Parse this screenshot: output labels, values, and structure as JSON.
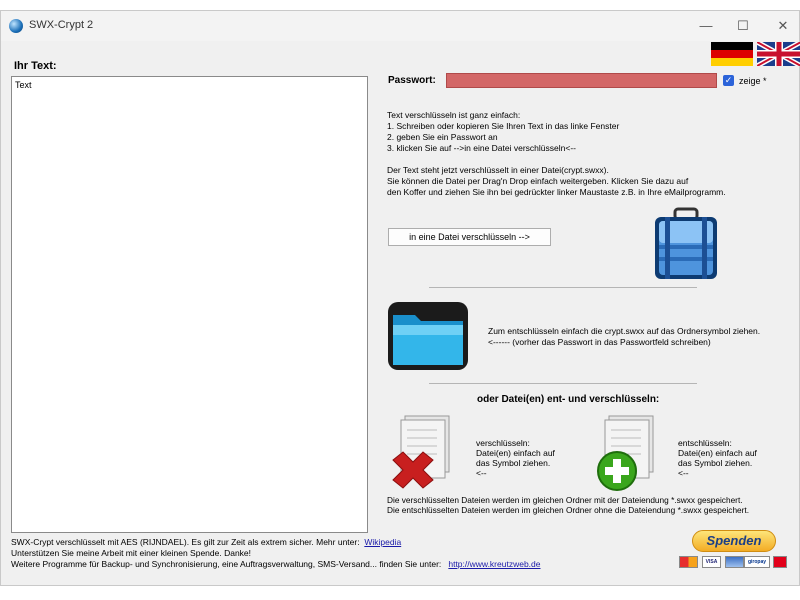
{
  "window": {
    "title": "SWX-Crypt 2",
    "controls": {
      "minimize": "—",
      "maximize": "☐",
      "close": "✕"
    }
  },
  "left": {
    "heading": "Ihr Text:",
    "text_value": "Text"
  },
  "password": {
    "label": "Passwort:",
    "show_checkbox": {
      "checked": true,
      "label": "zeige *"
    }
  },
  "instructions": [
    "Text verschlüsseln ist ganz einfach:",
    "1. Schreiben oder kopieren Sie Ihren Text in das linke Fenster",
    "2. geben Sie ein Passwort an",
    "3. klicken Sie auf -->in eine Datei verschlüsseln<--",
    "",
    "Der Text steht jetzt verschlüsselt in einer Datei(crypt.swxx).",
    "Sie können die Datei per Drag'n Drop einfach weitergeben. Klicken Sie dazu auf",
    "den Koffer und ziehen Sie ihn bei gedrückter linker Maustaste z.B. in Ihre eMailprogramm."
  ],
  "encrypt_button": "in eine Datei verschlüsseln -->",
  "decrypt_text": [
    "Zum entschlüsseln einfach die crypt.swxx auf das Ordnersymbol ziehen.",
    "<------ (vorher das Passwort in das Passwortfeld schreiben)"
  ],
  "files_heading": "oder Datei(en) ent- und verschlüsseln:",
  "encrypt_files_text": [
    "verschlüsseln:",
    "Datei(en) einfach auf",
    "das Symbol ziehen.",
    "<--"
  ],
  "decrypt_files_text": [
    "entschlüsseln:",
    "Datei(en) einfach auf",
    "das Symbol ziehen.",
    "<--"
  ],
  "notes": [
    "Die verschlüsselten Dateien werden im gleichen Ordner mit der Dateiendung *.swxx gespeichert.",
    "Die entschlüsselten Dateien werden im gleichen Ordner ohne die Dateiendung *.swxx gespeichert."
  ],
  "footer": {
    "line1": "SWX-Crypt verschlüsselt mit AES (RIJNDAEL). Es gilt zur Zeit  als extrem sicher. Mehr unter:",
    "line1_link": "Wikipedia",
    "line2": "Unterstützen Sie meine Arbeit mit einer kleinen Spende.  Danke!",
    "line3": "Weitere Programme für Backup- und Synchronisierung, eine Auftragsverwaltung, SMS-Versand... finden Sie unter:",
    "line3_link": "http://www.kreutzweb.de"
  },
  "donate_button": "Spenden",
  "payment_cards": [
    "",
    "VISA",
    "",
    "giropay",
    ""
  ],
  "colors": {
    "password_field": "#d36767",
    "checkbox": "#2b63d9",
    "link": "#1a1aa8"
  }
}
